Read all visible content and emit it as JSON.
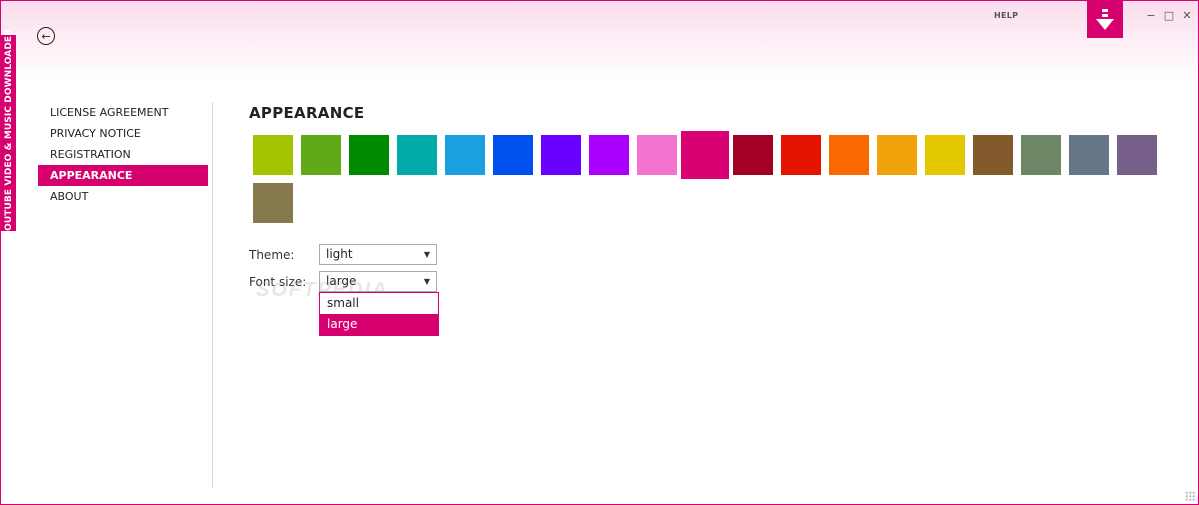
{
  "app": {
    "vertical_title": "YOUTUBE VIDEO & MUSIC DOWNLOADER",
    "help_label": "HELP",
    "brand_color": "#d6006e",
    "back_icon": "back-arrow-icon",
    "download_icon": "download-icon",
    "minimize_glyph": "−",
    "maximize_glyph": "□",
    "close_glyph": "✕"
  },
  "sidebar": {
    "items": [
      {
        "label": "LICENSE AGREEMENT",
        "active": false
      },
      {
        "label": "PRIVACY NOTICE",
        "active": false
      },
      {
        "label": "REGISTRATION",
        "active": false
      },
      {
        "label": "APPEARANCE",
        "active": true
      },
      {
        "label": "ABOUT",
        "active": false
      }
    ]
  },
  "main": {
    "title": "APPEARANCE",
    "accent_colors": [
      "#a4c400",
      "#60a917",
      "#008a00",
      "#00aba9",
      "#1ba1e2",
      "#0050ef",
      "#6a00ff",
      "#aa00ff",
      "#f472d0",
      "#d80073",
      "#a20025",
      "#e51400",
      "#fa6800",
      "#f0a30a",
      "#e3c800",
      "#825a2c",
      "#6d8764",
      "#647687",
      "#76608a",
      "#87794e"
    ],
    "selected_color_index": 9,
    "theme": {
      "label": "Theme:",
      "value": "light"
    },
    "font_size": {
      "label": "Font size:",
      "value": "large",
      "options": [
        "small",
        "large"
      ],
      "selected_option": "large"
    },
    "watermark": "SOFTPEDIA"
  }
}
